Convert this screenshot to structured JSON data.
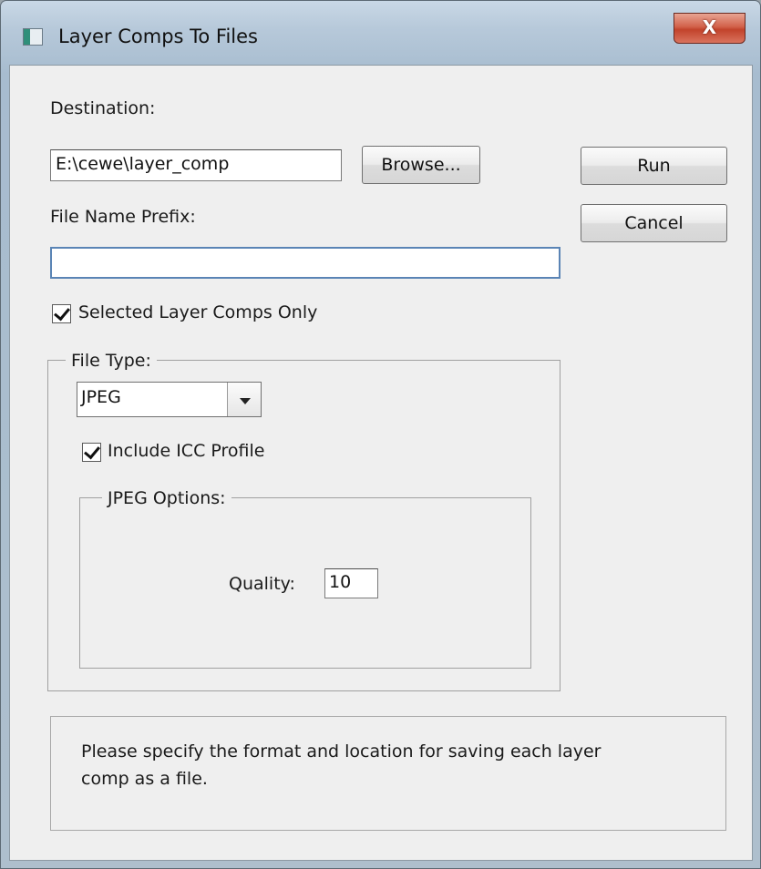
{
  "window": {
    "title": "Layer Comps To Files",
    "close_label": "X"
  },
  "destination": {
    "label": "Destination:",
    "value": "E:\\cewe\\layer_comp",
    "browse_label": "Browse..."
  },
  "actions": {
    "run_label": "Run",
    "cancel_label": "Cancel"
  },
  "prefix": {
    "label": "File Name Prefix:",
    "value": ""
  },
  "selected_only": {
    "label": "Selected Layer Comps Only",
    "checked": true
  },
  "file_type": {
    "legend": "File Type:",
    "selected": "JPEG",
    "icc": {
      "label": "Include ICC Profile",
      "checked": true
    }
  },
  "jpeg_options": {
    "legend": "JPEG Options:",
    "quality_label": "Quality:",
    "quality_value": "10"
  },
  "help": {
    "text_line1": "Please specify the format and location for saving each layer",
    "text_line2": "comp as a file."
  }
}
